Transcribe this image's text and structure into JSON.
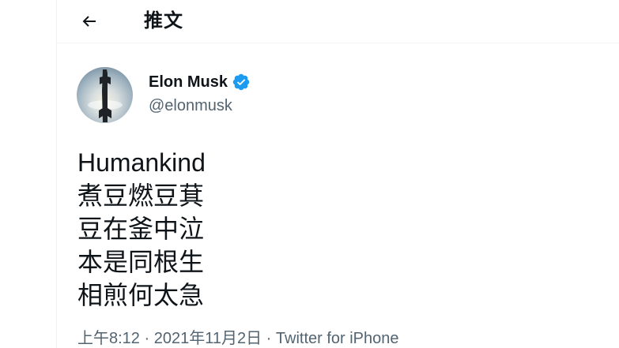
{
  "header": {
    "title": "推文",
    "back_icon": "arrow-left-icon"
  },
  "author": {
    "name": "Elon Musk",
    "handle": "@elonmusk",
    "verified_icon": "verified-badge-icon",
    "verified_color": "#1d9bf0"
  },
  "tweet": {
    "lines": [
      "Humankind",
      "煮豆燃豆萁",
      "豆在釜中泣",
      "本是同根生",
      "相煎何太急"
    ]
  },
  "meta": {
    "time": "上午8:12",
    "separator": " · ",
    "date": "2021年11月2日",
    "source": "Twitter for iPhone"
  },
  "colors": {
    "text": "#0f1419",
    "secondary_text": "#536471",
    "accent": "#1d9bf0"
  }
}
